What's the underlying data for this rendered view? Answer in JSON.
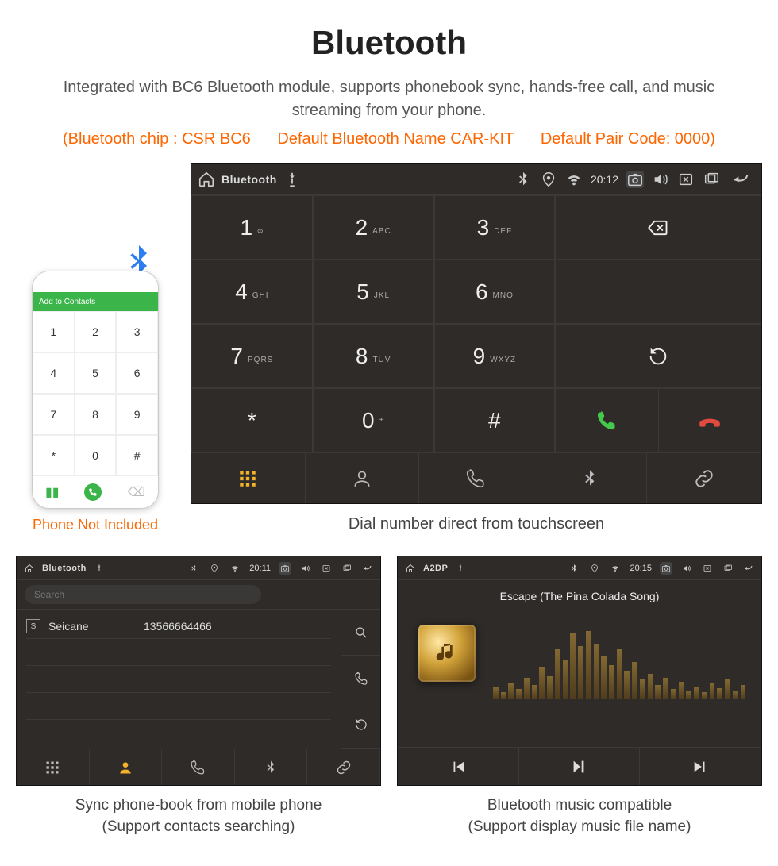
{
  "header": {
    "title": "Bluetooth",
    "subtitle": "Integrated with BC6 Bluetooth module, supports phonebook sync, hands-free call, and music streaming from your phone.",
    "spec_chip": "(Bluetooth chip : CSR BC6",
    "spec_name": "Default Bluetooth Name CAR-KIT",
    "spec_pair": "Default Pair Code: 0000)"
  },
  "phone_mock": {
    "bar_label": "Add to Contacts",
    "caption": "Phone Not Included"
  },
  "dialer": {
    "statusbar": {
      "title": "Bluetooth",
      "time": "20:12"
    },
    "keys": [
      {
        "d": "1",
        "s": "∞"
      },
      {
        "d": "2",
        "s": "ABC"
      },
      {
        "d": "3",
        "s": "DEF"
      },
      {
        "d": "4",
        "s": "GHI"
      },
      {
        "d": "5",
        "s": "JKL"
      },
      {
        "d": "6",
        "s": "MNO"
      },
      {
        "d": "7",
        "s": "PQRS"
      },
      {
        "d": "8",
        "s": "TUV"
      },
      {
        "d": "9",
        "s": "WXYZ"
      },
      {
        "d": "*",
        "s": ""
      },
      {
        "d": "0",
        "s": "+"
      },
      {
        "d": "#",
        "s": ""
      }
    ],
    "caption": "Dial number direct from touchscreen"
  },
  "contacts": {
    "statusbar": {
      "title": "Bluetooth",
      "time": "20:11"
    },
    "search_placeholder": "Search",
    "list": [
      {
        "initial": "S",
        "name": "Seicane",
        "number": "13566664466"
      }
    ],
    "caption_l1": "Sync phone-book from mobile phone",
    "caption_l2": "(Support contacts searching)"
  },
  "music": {
    "statusbar": {
      "title": "A2DP",
      "time": "20:15"
    },
    "track": "Escape (The Pina Colada Song)",
    "caption_l1": "Bluetooth music compatible",
    "caption_l2": "(Support display music file name)"
  }
}
